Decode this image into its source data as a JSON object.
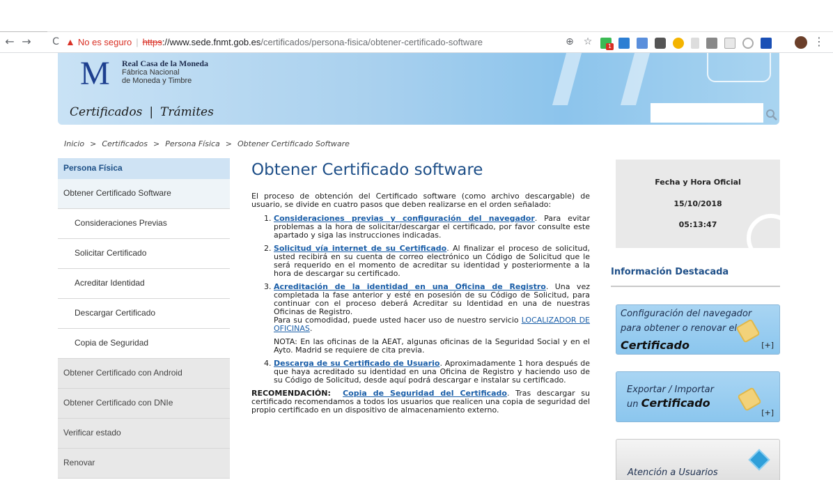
{
  "browser": {
    "omnibox": {
      "warning": "No es seguro",
      "separator": "|",
      "scheme": "https",
      "host": "://www.sede.fnmt.gob.es",
      "path": "/certificados/persona-fisica/obtener-certificado-software"
    },
    "extension_badge": "1"
  },
  "header": {
    "logo_mark": "M",
    "logo_line1": "Real Casa de la Moneda",
    "logo_line2": "Fábrica Nacional",
    "logo_line3": "de Moneda y Timbre",
    "nav_certificados": "Certificados",
    "nav_sep": "|",
    "nav_tramites": "Trámites",
    "search_value": ""
  },
  "breadcrumb": [
    "Inicio",
    "Certificados",
    "Persona Física",
    "Obtener Certificado Software"
  ],
  "breadcrumb_sep": ">",
  "sidebar": {
    "heading": "Persona Física",
    "items": [
      "Obtener Certificado Software",
      "Consideraciones Previas",
      "Solicitar Certificado",
      "Acreditar Identidad",
      "Descargar Certificado",
      "Copia de Seguridad",
      "Obtener Certificado con Android",
      "Obtener Certificado con DNIe",
      "Verificar estado",
      "Renovar"
    ]
  },
  "main": {
    "title": "Obtener Certificado software",
    "intro": "El proceso de obtención del Certificado software (como archivo descargable) de usuario, se divide en cuatro pasos que deben realizarse en el orden señalado:",
    "steps": [
      {
        "link": "Consideraciones previas y configuración del navegador",
        "text": ". Para evitar problemas a la hora de solicitar/descargar el certificado, por favor consulte este apartado y siga las instrucciones indicadas."
      },
      {
        "link": "Solicitud vía internet de su Certificado",
        "text": ". Al finalizar el proceso de solicitud, usted recibirá en su cuenta de correo electrónico un Código de Solicitud que le será requerido en el momento de acreditar su identidad y posteriormente a la hora de descargar su certificado."
      },
      {
        "link": "Acreditación de la identidad en una Oficina de Registro",
        "text": ". Una vez completada la fase anterior y esté en posesión de su Código de Solicitud, para continuar con el proceso deberá Acreditar su Identidad en una de nuestras Oficinas de Registro.",
        "extra": "Para su comodidad, puede usted hacer uso de nuestro servicio ",
        "extra_link": "LOCALIZADOR DE OFICINAS",
        "extra_end": "."
      },
      {
        "link": "Descarga de su Certificado de Usuario",
        "text": ". Aproximadamente 1 hora después de que haya acreditado su identidad en una Oficina de Registro y haciendo uso de su Código de Solicitud, desde aquí podrá descargar e instalar su certificado."
      }
    ],
    "note": "NOTA: En las oficinas de la AEAT, algunas oficinas de la Seguridad Social y en el Ayto. Madrid se requiere de cita previa.",
    "rec_label": "RECOMENDACIÓN:",
    "rec_link": "Copia de Seguridad del Certificado",
    "rec_text": ". Tras descargar su certificado recomendamos a todos los usuarios que realicen una copia de seguridad del propio certificado en un dispositivo de almacenamiento externo."
  },
  "clock": {
    "title": "Fecha y Hora Oficial",
    "date": "15/10/2018",
    "time": "05:13:47"
  },
  "info": {
    "title": "Información Destacada",
    "promo1_l1": "Configuración del navegador",
    "promo1_l2": "para obtener o renovar el",
    "promo1_l3": "Certificado",
    "promo2_l1": "Exportar / Importar",
    "promo2_l2a": "un ",
    "promo2_l2b": "Certificado",
    "plus": "[+]",
    "attention": "Atención a Usuarios"
  }
}
